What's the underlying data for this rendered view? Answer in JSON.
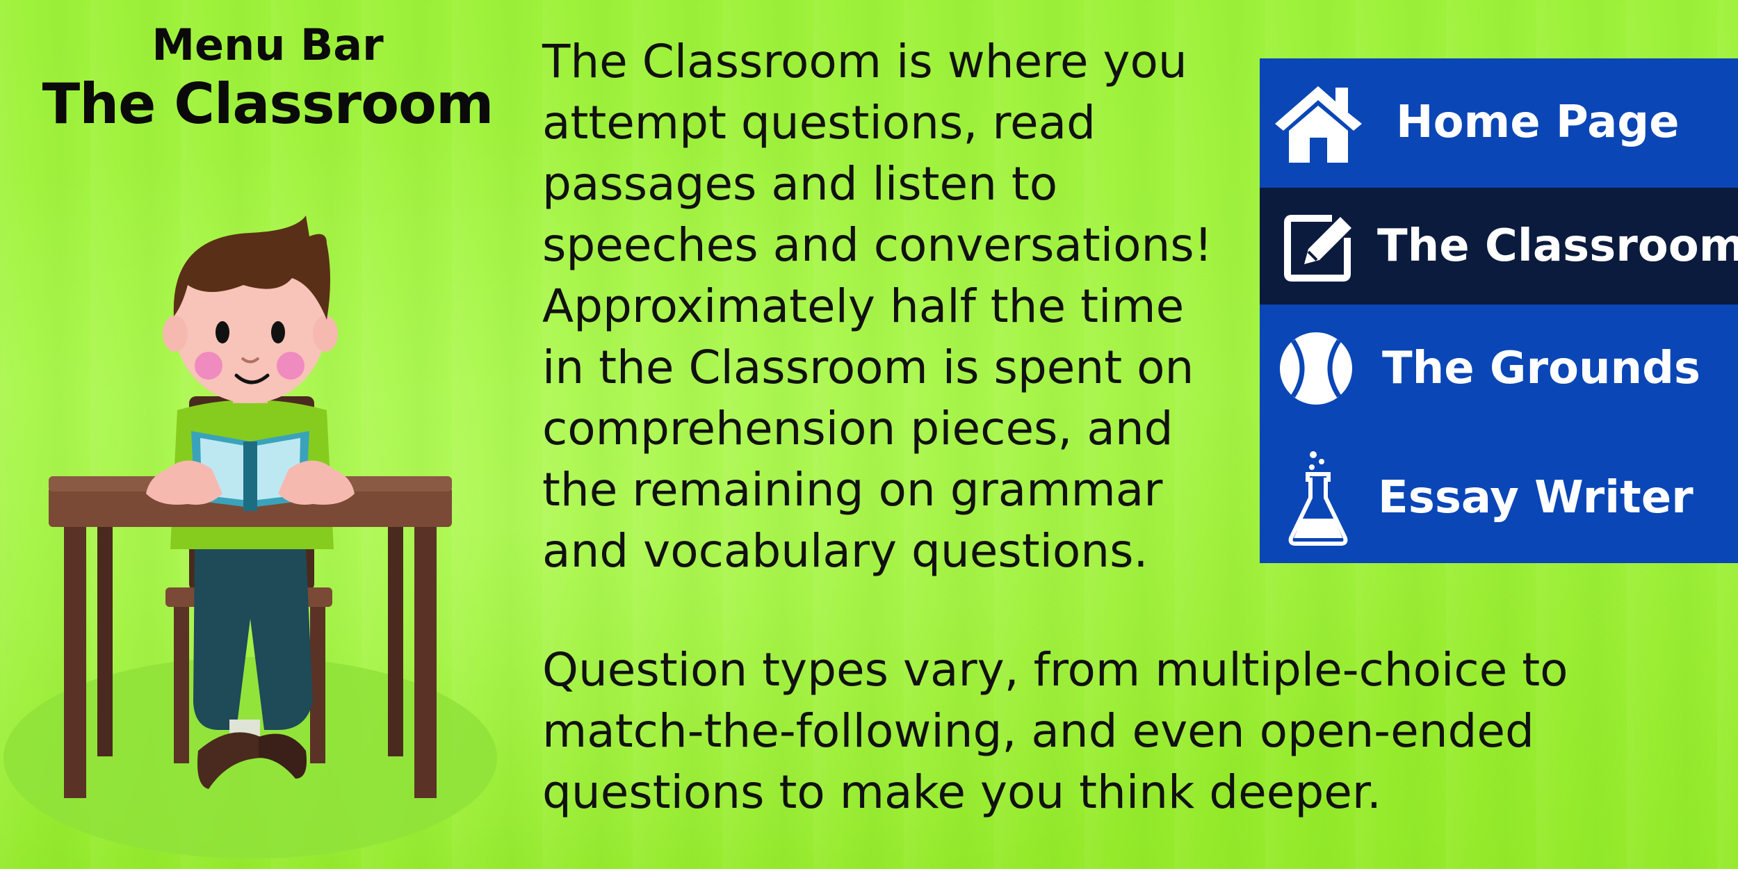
{
  "header": {
    "menu_bar_label": "Menu Bar",
    "title": "The Classroom"
  },
  "body": {
    "paragraph_1": "The Classroom is where you\nattempt questions, read\npassages and listen to\nspeeches and conversations!\nApproximately half the time\nin the Classroom is spent on\ncomprehension pieces, and\nthe remaining on grammar\nand vocabulary questions.",
    "paragraph_2": "Question types vary, from multiple-choice to\nmatch-the-following, and even open-ended\nquestions to make you think deeper."
  },
  "menu": {
    "items": [
      {
        "label": "Home Page",
        "icon": "home-icon",
        "active": false
      },
      {
        "label": "The Classroom",
        "icon": "edit-icon",
        "active": true
      },
      {
        "label": "The Grounds",
        "icon": "ball-icon",
        "active": false
      },
      {
        "label": "Essay Writer",
        "icon": "flask-icon",
        "active": false
      }
    ]
  },
  "colors": {
    "background": "#a6f547",
    "menu": "#0a46b6",
    "menu_active": "#0b1b3e",
    "text": "#111111"
  }
}
